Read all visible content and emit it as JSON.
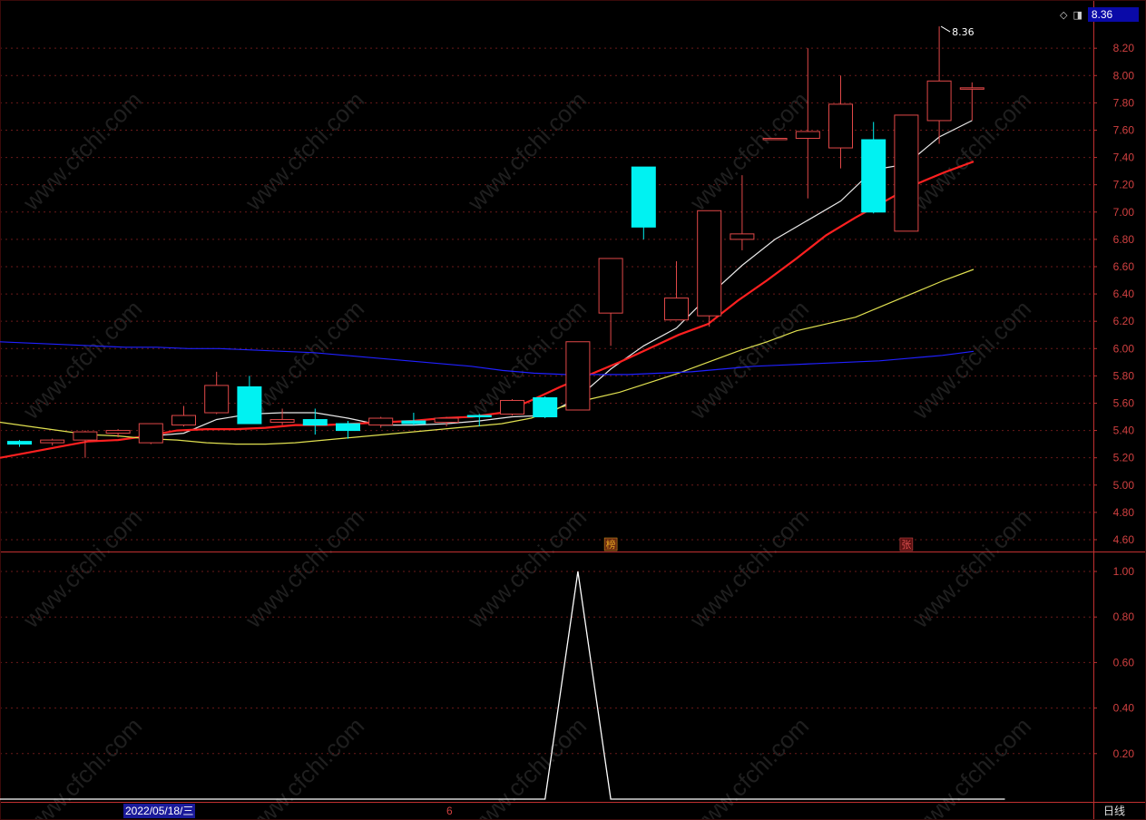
{
  "header": {
    "price_badge": "8.36"
  },
  "footer": {
    "cursor_date": "2022/05/18/三",
    "x_mark": "6",
    "period_label": "日线"
  },
  "colors": {
    "bg": "#000000",
    "grid": "#6a1a1a",
    "axis": "#c03030",
    "up": "#e04848",
    "down": "#00f2f2",
    "ma5": "#e8e8e8",
    "ma10": "#ff2020",
    "ma20": "#e0e050",
    "ma60": "#2020ff",
    "indicator": "#ffffff"
  },
  "watermark": "www.cfchi.com",
  "chart_data": [
    {
      "type": "candlestick",
      "y_ticks": [
        "8.20",
        "8.00",
        "7.80",
        "7.60",
        "7.40",
        "7.20",
        "7.00",
        "6.80",
        "6.60",
        "6.40",
        "6.20",
        "6.00",
        "5.80",
        "5.60",
        "5.40",
        "5.20",
        "5.00",
        "4.80",
        "4.60"
      ],
      "ylim": [
        4.56,
        8.45
      ],
      "high_label": "8.36",
      "candles": [
        {
          "o": 5.32,
          "h": 5.33,
          "l": 5.28,
          "c": 5.3
        },
        {
          "o": 5.31,
          "h": 5.34,
          "l": 5.29,
          "c": 5.33
        },
        {
          "o": 5.33,
          "h": 5.4,
          "l": 5.2,
          "c": 5.39
        },
        {
          "o": 5.38,
          "h": 5.41,
          "l": 5.35,
          "c": 5.4
        },
        {
          "o": 5.31,
          "h": 5.45,
          "l": 5.3,
          "c": 5.45
        },
        {
          "o": 5.44,
          "h": 5.58,
          "l": 5.43,
          "c": 5.51
        },
        {
          "o": 5.53,
          "h": 5.83,
          "l": 5.52,
          "c": 5.73
        },
        {
          "o": 5.72,
          "h": 5.8,
          "l": 5.45,
          "c": 5.45
        },
        {
          "o": 5.46,
          "h": 5.56,
          "l": 5.44,
          "c": 5.48
        },
        {
          "o": 5.48,
          "h": 5.56,
          "l": 5.37,
          "c": 5.44
        },
        {
          "o": 5.45,
          "h": 5.47,
          "l": 5.34,
          "c": 5.4
        },
        {
          "o": 5.44,
          "h": 5.5,
          "l": 5.42,
          "c": 5.49
        },
        {
          "o": 5.47,
          "h": 5.53,
          "l": 5.44,
          "c": 5.45
        },
        {
          "o": 5.46,
          "h": 5.5,
          "l": 5.43,
          "c": 5.49
        },
        {
          "o": 5.51,
          "h": 5.52,
          "l": 5.43,
          "c": 5.5
        },
        {
          "o": 5.52,
          "h": 5.63,
          "l": 5.51,
          "c": 5.62
        },
        {
          "o": 5.64,
          "h": 5.65,
          "l": 5.49,
          "c": 5.5
        },
        {
          "o": 5.55,
          "h": 6.05,
          "l": 5.55,
          "c": 6.05
        },
        {
          "o": 6.26,
          "h": 6.66,
          "l": 6.02,
          "c": 6.66
        },
        {
          "o": 7.33,
          "h": 7.33,
          "l": 6.8,
          "c": 6.89
        },
        {
          "o": 6.21,
          "h": 6.64,
          "l": 6.21,
          "c": 6.37
        },
        {
          "o": 6.24,
          "h": 7.01,
          "l": 6.16,
          "c": 7.01
        },
        {
          "o": 6.8,
          "h": 7.27,
          "l": 6.72,
          "c": 6.84
        },
        {
          "o": 7.54,
          "h": 7.54,
          "l": 7.53,
          "c": 7.54
        },
        {
          "o": 7.54,
          "h": 8.2,
          "l": 7.1,
          "c": 7.59
        },
        {
          "o": 7.47,
          "h": 8.0,
          "l": 7.32,
          "c": 7.79
        },
        {
          "o": 7.53,
          "h": 7.66,
          "l": 6.99,
          "c": 7.0
        },
        {
          "o": 6.86,
          "h": 7.71,
          "l": 6.86,
          "c": 7.71
        },
        {
          "o": 7.67,
          "h": 8.36,
          "l": 7.5,
          "c": 7.96
        },
        {
          "o": 7.9,
          "h": 7.95,
          "l": 7.67,
          "c": 7.91
        }
      ],
      "series": [
        {
          "name": "MA5",
          "color": "#e8e8e8",
          "values": [
            null,
            null,
            null,
            null,
            5.36,
            5.38,
            5.48,
            5.52,
            5.53,
            5.53,
            5.49,
            5.44,
            5.44,
            5.45,
            5.47,
            5.5,
            5.51,
            5.64,
            5.85,
            6.02,
            6.15,
            6.39,
            6.61,
            6.8,
            6.94,
            7.08,
            7.31,
            7.35,
            7.55,
            7.67
          ]
        },
        {
          "name": "MA10",
          "color": "#ff2020",
          "values": [
            5.2,
            5.24,
            5.28,
            5.32,
            5.33,
            5.36,
            5.4,
            5.41,
            5.41,
            5.42,
            5.44,
            5.44,
            5.45,
            5.46,
            5.47,
            5.49,
            5.5,
            5.53,
            5.62,
            5.72,
            5.81,
            5.9,
            6.0,
            6.1,
            6.18,
            6.35,
            6.5,
            6.66,
            6.83,
            6.96,
            7.08,
            7.2,
            7.29,
            7.37
          ]
        },
        {
          "name": "MA20",
          "color": "#e0e050",
          "values": [
            5.46,
            5.43,
            5.4,
            5.37,
            5.36,
            5.34,
            5.33,
            5.31,
            5.3,
            5.3,
            5.31,
            5.33,
            5.35,
            5.37,
            5.39,
            5.41,
            5.43,
            5.45,
            5.49,
            5.57,
            5.63,
            5.68,
            5.75,
            5.82,
            5.9,
            5.98,
            6.05,
            6.13,
            6.18,
            6.23,
            6.32,
            6.41,
            6.5,
            6.58
          ]
        },
        {
          "name": "MA60",
          "color": "#2020ff",
          "values": [
            6.05,
            6.04,
            6.03,
            6.02,
            6.01,
            6.01,
            6.0,
            6.0,
            5.99,
            5.98,
            5.97,
            5.95,
            5.93,
            5.91,
            5.89,
            5.87,
            5.84,
            5.82,
            5.81,
            5.81,
            5.81,
            5.82,
            5.83,
            5.85,
            5.87,
            5.88,
            5.89,
            5.9,
            5.91,
            5.93,
            5.95,
            5.98
          ]
        }
      ],
      "markers": [
        {
          "text": "榜",
          "index": 18,
          "color": "#e0a020",
          "bg": "#6a2a10"
        },
        {
          "text": "张",
          "index": 27,
          "color": "#e05050",
          "bg": "#5a1010"
        }
      ]
    },
    {
      "type": "line",
      "y_ticks": [
        "1.00",
        "0.80",
        "0.60",
        "0.40",
        "0.20"
      ],
      "ylim": [
        0,
        1.0
      ],
      "x_points": [
        0,
        16,
        17,
        18,
        30
      ],
      "values": [
        0,
        0,
        1,
        0,
        0
      ]
    }
  ]
}
